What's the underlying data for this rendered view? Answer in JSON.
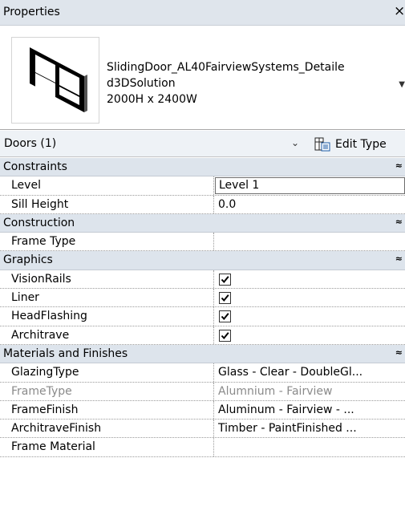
{
  "panel": {
    "title": "Properties",
    "close_glyph": "×"
  },
  "type_selector": {
    "name_lines": [
      "SlidingDoor_AL40FairviewSystems_Detaile",
      "d3DSolution",
      "2000H x 2400W"
    ],
    "preview_icon": "window-preview-icon",
    "dropdown_glyph": "▼"
  },
  "instance_selector": {
    "label": "Doors (1)",
    "chevron": "⌄",
    "edit_type_label": "Edit Type"
  },
  "groups": [
    {
      "label": "Constraints",
      "collapse": "≈",
      "rows": [
        {
          "label": "Level",
          "value": "Level 1",
          "kind": "input"
        },
        {
          "label": "Sill Height",
          "value": "0.0",
          "kind": "text"
        }
      ]
    },
    {
      "label": "Construction",
      "collapse": "≈",
      "rows": [
        {
          "label": "Frame Type",
          "value": "",
          "kind": "text"
        }
      ]
    },
    {
      "label": "Graphics",
      "collapse": "≈",
      "rows": [
        {
          "label": "VisionRails",
          "checked": true,
          "kind": "checkbox"
        },
        {
          "label": "Liner",
          "checked": true,
          "kind": "checkbox"
        },
        {
          "label": "HeadFlashing",
          "checked": true,
          "kind": "checkbox"
        },
        {
          "label": "Architrave",
          "checked": true,
          "kind": "checkbox"
        }
      ]
    },
    {
      "label": "Materials and Finishes",
      "collapse": "≈",
      "rows": [
        {
          "label": "GlazingType",
          "value": "Glass - Clear - DoubleGl...",
          "kind": "text"
        },
        {
          "label": "FrameType",
          "value": "Alumnium - Fairview",
          "kind": "text",
          "disabled": true
        },
        {
          "label": "FrameFinish",
          "value": "Aluminum - Fairview - ...",
          "kind": "text"
        },
        {
          "label": "ArchitraveFinish",
          "value": "Timber - PaintFinished ...",
          "kind": "text"
        },
        {
          "label": "Frame Material",
          "value": "",
          "kind": "text"
        }
      ]
    }
  ]
}
